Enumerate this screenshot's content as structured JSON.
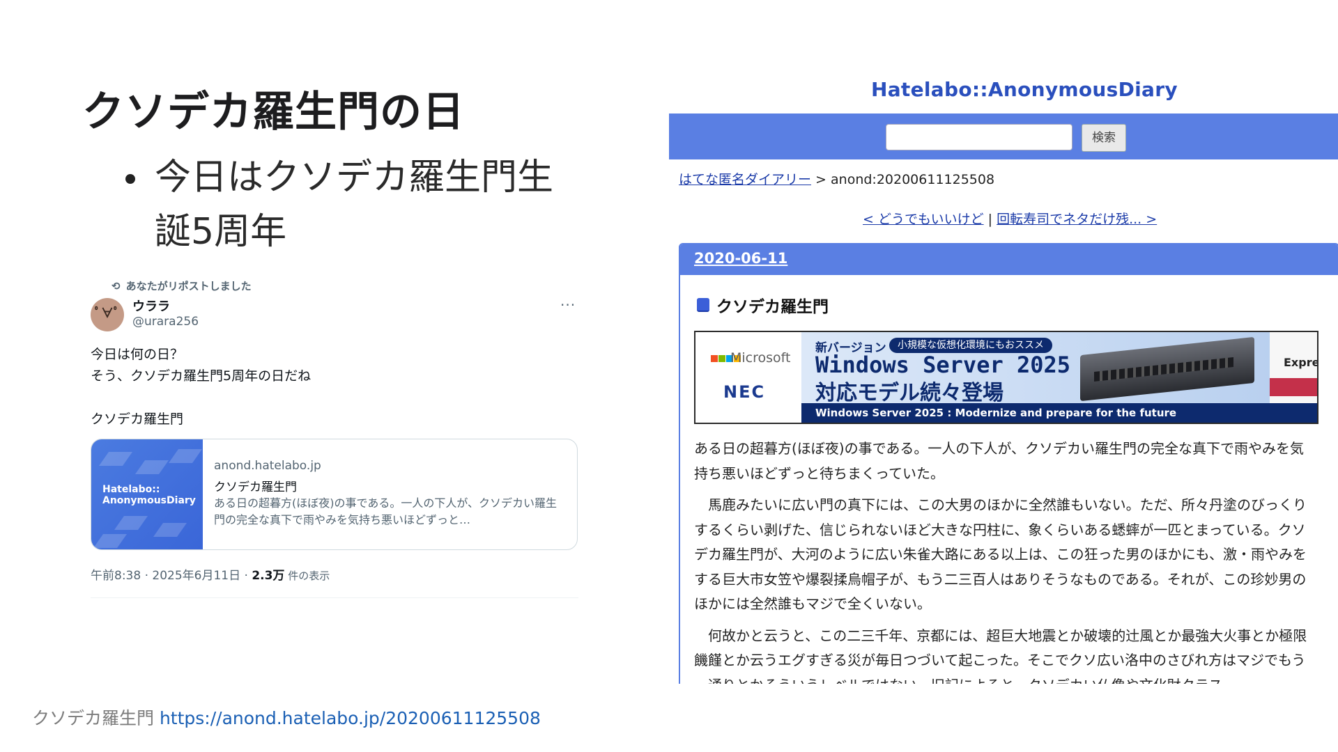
{
  "slide": {
    "title": "クソデカ羅生門の日",
    "bullet": "今日はクソデカ羅生門生誕5周年"
  },
  "tweet": {
    "repost_label": "あなたがリポストしました",
    "repost_icon": "repost-icon",
    "avatar_glyph": "ﾟ∀ﾟ",
    "user_name": "ウララ",
    "user_handle": "@urara256",
    "more_label": "···",
    "text": "今日は何の日？\nそう、クソデカ羅生門5周年の日だね\n\nクソデカ羅生門",
    "card": {
      "brand": "Hatelabo::\nAnonymousDiary",
      "domain": "anond.hatelabo.jp",
      "title": "クソデカ羅生門",
      "description": "ある日の超暮方(ほぼ夜)の事である。一人の下人が、クソデカい羅生門の完全な真下で雨やみを気持ち悪いほどずっと…"
    },
    "meta": {
      "time_date": "午前8:38 · 2025年6月11日 · ",
      "views": "2.3万",
      "views_label": " 件の表示"
    }
  },
  "footer": {
    "label": "クソデカ羅生門 ",
    "url": "https://anond.hatelabo.jp/20200611125508"
  },
  "anond": {
    "logo": "Hatelabo::AnonymousDiary",
    "search_button": "検索",
    "search_placeholder": "",
    "breadcrumb_link": "はてな匿名ダイアリー",
    "breadcrumb_rest": " > anond:20200611125508",
    "prev_link": "< どうでもいいけど",
    "pager_sep": " | ",
    "next_link": "回転寿司でネタだけ残... >",
    "date": "2020-06-11",
    "entry_title": "クソデカ羅生門",
    "ad": {
      "ms": "Microsoft",
      "nec": "NEC",
      "new_version": "新バージョン",
      "pill": "小規模な仮想化環境にもおススメ",
      "headline1": "Windows Server 2025",
      "headline2": "対応モデル続々登場",
      "strip": "Windows Server 2025 : Modernize and prepare for the future",
      "right": "Expre"
    },
    "paragraphs": [
      "ある日の超暮方(ほぼ夜)の事である。一人の下人が、クソデカい羅生門の完全な真下で雨やみを気持ち悪いほどずっと待ちまくっていた。",
      "馬鹿みたいに広い門の真下には、この大男のほかに全然誰もいない。ただ、所々丹塗のびっくりするくらい剥げた、信じられないほど大きな円柱に、象くらいある蟋蟀が一匹とまっている。クソデカ羅生門が、大河のように広い朱雀大路にある以上は、この狂った男のほかにも、激・雨やみをする巨大市女笠や爆裂揉烏帽子が、もう二三百人はありそうなものである。それが、この珍妙男のほかには全然誰もマジで全くいない。",
      "何故かと云うと、この二三千年、京都には、超巨大地震とか破壊的辻風とか最強大火事とか極限饑饉とか云うエグすぎる災が毎日つづいて起こった。そこでクソ広い洛中のさびれ方はマジでもう一通りとかそういうレベルではない。旧記によると、クソデカい仏像や文化財クラス"
    ]
  }
}
